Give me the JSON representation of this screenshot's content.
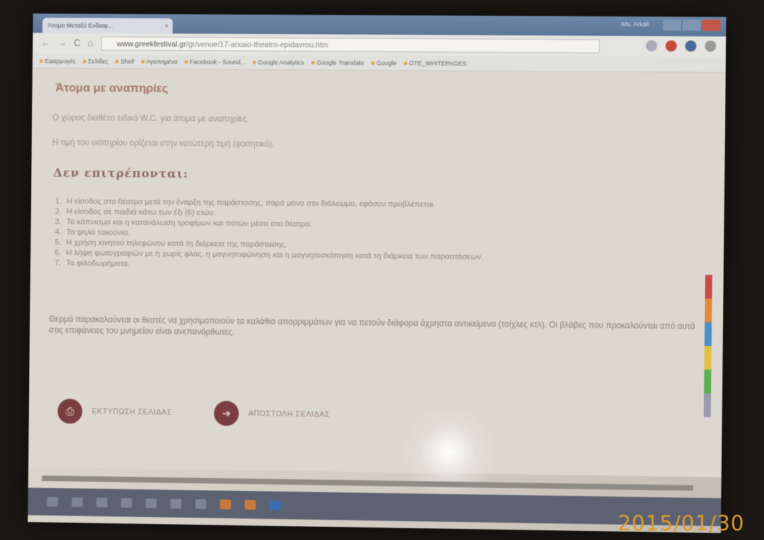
{
  "browser": {
    "tab_title": "Άτομα Μεταξύ Ενδιαφ...",
    "tab_close": "×",
    "profile": "Ms. Arkali",
    "url_domain": "www.greekfestival.gr",
    "url_path": "/gr/venue/17-arxaio-theatro-epidavrou.htm",
    "nav": {
      "back": "←",
      "forward": "→",
      "reload": "C",
      "home": "⌂"
    },
    "bookmarks": [
      "Εφαρμογές",
      "Σελίδες",
      "Shell",
      "Αγαπημένα",
      "Facebook - Sound...",
      "Google Analytics",
      "Google Translate",
      "Google",
      "OTE_WHITEPAGES"
    ]
  },
  "page": {
    "heading": "Άτομα με αναπηρίες",
    "para1": "Ο χώρος διαθέτει ειδικό W.C. για άτομα με αναπηρίες.",
    "para2": "Η τιμή του εισιτηρίου ορίζεται στην κατώτερη τιμή (φοιτητικό).",
    "not_allowed_heading": "Δεν επιτρέπονται:",
    "rules": [
      "Η είσοδος στο θέατρο μετά την έναρξη της παράστασης, παρά μόνο στο διάλειμμα, εφόσον προβλέπεται.",
      "Η είσοδος σε παιδιά κάτω των έξι (6) ετών.",
      "Το κάπνισμα και η κατανάλωση τροφίμων και ποτών μέσα στο θέατρο.",
      "Τα ψηλά τακούνια.",
      "Η χρήση κινητού τηλεφώνου κατά τη διάρκεια της παράστασης.",
      "Η λήψη φωτογραφιών με ή χωρίς φλας, η μαγνητοφώνηση και η μαγνητοσκόπηση κατά τη διάρκεια των παραστάσεων.",
      "Τα φιλοδωρήματα."
    ],
    "notice": "Θερμά παρακαλούνται οι θεατές να χρησιμοποιούν τα καλάθια απορριμμάτων για να πετούν διάφορα άχρηστα αντικείμενα (τσίχλες κτλ). Οι βλάβες που προκαλούνται από αυτά στις επιφάνειες του μνημείου είναι ανεπανόρθωτες.",
    "print_label": "ΕΚΤΥΠΩΣΗ ΣΕΛΙΔΑΣ",
    "send_label": "ΑΠΟΣΤΟΛΗ ΣΕΛΙΔΑΣ"
  },
  "scrollbar_colors": [
    "#c94a4a",
    "#e08a3a",
    "#4a90c8",
    "#e0c040",
    "#5ab050",
    "#9a9ab0"
  ],
  "date_stamp": "2015/01/30"
}
